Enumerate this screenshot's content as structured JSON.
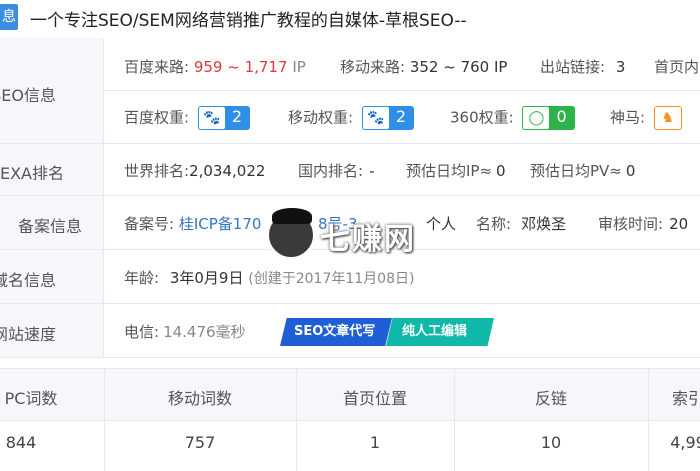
{
  "header": {
    "badge": "息",
    "title": "一个专注SEO/SEM网络营销推广教程的自媒体-草根SEO--"
  },
  "rows": {
    "seo": {
      "label": "SEO信息",
      "baidu_label": "百度来路:",
      "baidu_value": "959 ~ 1,717",
      "baidu_unit": "IP",
      "mobile_label": "移动来路:",
      "mobile_value": "352 ~ 760 IP",
      "outlinks_label": "出站链接:",
      "outlinks_value": "3",
      "home_label": "首页内"
    },
    "weights": {
      "baidu_label": "百度权重:",
      "baidu_value": "2",
      "mobile_label": "移动权重:",
      "mobile_value": "2",
      "w360_label": "360权重:",
      "w360_value": "0",
      "shenma_label": "神马:"
    },
    "alexa": {
      "label": "ALEXA排名",
      "world_label": "世界排名:",
      "world_value": "2,034,022",
      "domestic_label": "国内排名:",
      "domestic_value": "-",
      "ip_label": "预估日均IP≈",
      "ip_value": "0",
      "pv_label": "预估日均PV≈",
      "pv_value": "0"
    },
    "beian": {
      "label": "备案信息",
      "no_label": "备案号:",
      "no_value": "桂ICP备170",
      "no_tail": "8号-3",
      "nature_value": "个人",
      "name_label": "名称:",
      "name_value": "邓焕圣",
      "audit_label": "审核时间:",
      "audit_value": "20"
    },
    "domain": {
      "label": "域名信息",
      "age_label": "年龄:",
      "age_value": "3年0月9日",
      "created": "(创建于2017年11月08日)"
    },
    "speed": {
      "label": "网站速度",
      "telecom_label": "电信:",
      "telecom_value": "14.476毫秒",
      "banner_left": "SEO文章代写",
      "banner_right": "纯人工编辑"
    }
  },
  "watermark": {
    "text": "七赚网"
  },
  "stats": {
    "headers": [
      "PC词数",
      "移动词数",
      "首页位置",
      "反链",
      "索引"
    ],
    "values": [
      "844",
      "757",
      "1",
      "10",
      "4,99"
    ]
  },
  "colors": {
    "accent": "#3b8ede",
    "red": "#e0393e",
    "link": "#3b74c5",
    "green": "#2db34a",
    "orange": "#f39020"
  }
}
